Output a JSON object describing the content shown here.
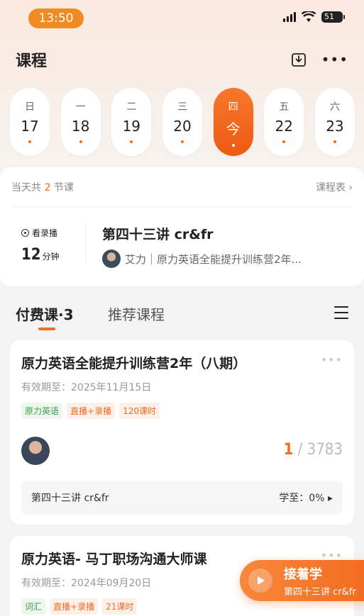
{
  "status_bar": {
    "time": "13:50",
    "battery": "51"
  },
  "header": {
    "title": "课程"
  },
  "week": [
    {
      "weekday": "日",
      "date": "17",
      "active": false
    },
    {
      "weekday": "一",
      "date": "18",
      "active": false
    },
    {
      "weekday": "二",
      "date": "19",
      "active": false
    },
    {
      "weekday": "三",
      "date": "20",
      "active": false
    },
    {
      "weekday": "四",
      "date": "今",
      "active": true
    },
    {
      "weekday": "五",
      "date": "22",
      "active": false
    },
    {
      "weekday": "六",
      "date": "23",
      "active": false
    }
  ],
  "today": {
    "count_prefix": "当天共",
    "count": "2",
    "count_suffix": "节课",
    "schedule_link": "课程表",
    "playback_label": "看录播",
    "duration_value": "12",
    "duration_unit": "分钟",
    "lesson_title": "第四十三讲 cr&fr",
    "teacher_line": "艾力｜原力英语全能提升训练营2年..."
  },
  "tabs": {
    "paid": "付费课·3",
    "recommend": "推荐课程"
  },
  "courses": [
    {
      "title": "原力英语全能提升训练营2年（八期）",
      "expire": "有效期至：2025年11月15日",
      "tags": [
        "原力英语",
        "直播+录播",
        "120课时"
      ],
      "progress_done": "1",
      "progress_total": " / 3783",
      "last_lesson": "第四十三讲 cr&fr",
      "last_progress": "学至：0% ▸"
    },
    {
      "title": "原力英语- 马丁职场沟通大师课",
      "expire": "有效期至：2024年09月20日",
      "tags": [
        "词汇",
        "直播+录播",
        "21课时"
      ]
    }
  ],
  "continue": {
    "label": "接着学",
    "sub": "第四十三讲 cr&fr"
  },
  "colors": {
    "accent": "#f26b22",
    "tag_green": "#3a9b4b"
  }
}
